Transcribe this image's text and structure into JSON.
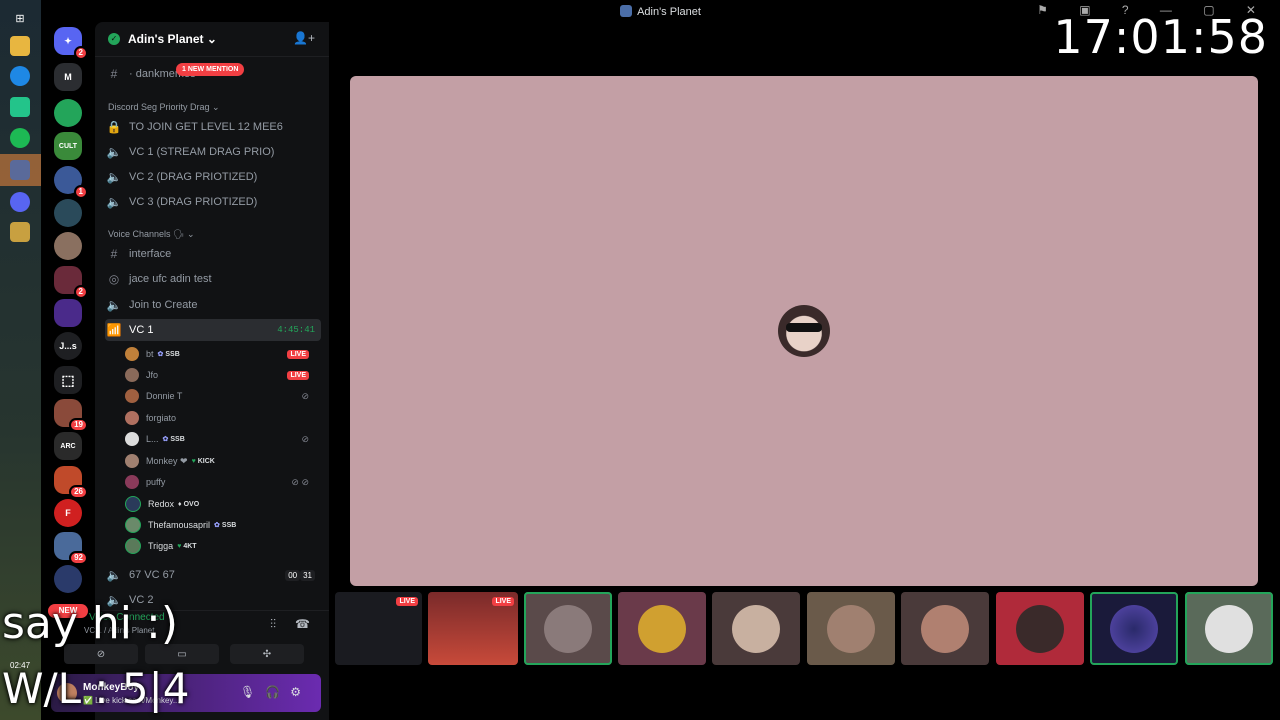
{
  "window": {
    "title": "Adin's Planet",
    "controls": "⚑ ▣ ? — ▢ ✕"
  },
  "clock": "17:01:58",
  "guilds": [
    {
      "name": "discord-home",
      "label": "",
      "color": "#5865f2",
      "badge": "2"
    },
    {
      "name": "mystic-madhouse",
      "label": "M",
      "color": "#2b2d31",
      "badge": ""
    },
    {
      "name": "green-hex",
      "label": "",
      "color": "#23a55a",
      "badge": ""
    },
    {
      "name": "battle-cult",
      "label": "CULT",
      "color": "#3a8a3a",
      "badge": ""
    },
    {
      "name": "server-5",
      "label": "",
      "color": "#3b5998",
      "badge": "1"
    },
    {
      "name": "server-6",
      "label": "",
      "color": "#2a4a5a",
      "badge": ""
    },
    {
      "name": "server-7",
      "label": "",
      "color": "#8a7060",
      "badge": ""
    },
    {
      "name": "server-8",
      "label": "",
      "color": "#6a2a3a",
      "badge": "2"
    },
    {
      "name": "server-9",
      "label": "",
      "color": "#4a2a8a",
      "badge": ""
    },
    {
      "name": "server-js",
      "label": "J...s",
      "color": "#1e1f22",
      "badge": ""
    },
    {
      "name": "server-11",
      "label": "",
      "color": "#1e1f22",
      "badge": ""
    },
    {
      "name": "server-12",
      "label": "",
      "color": "#8a4a3a",
      "badge": "19"
    },
    {
      "name": "arc-server",
      "label": "ARC",
      "color": "#2a2a2a",
      "badge": ""
    },
    {
      "name": "server-14",
      "label": "",
      "color": "#c04a2a",
      "badge": "26"
    },
    {
      "name": "server-15",
      "label": "F",
      "color": "#d02020",
      "badge": ""
    },
    {
      "name": "server-16",
      "label": "",
      "color": "#4a6a9a",
      "badge": "92"
    },
    {
      "name": "server-17",
      "label": "",
      "color": "#2a3a6a",
      "badge": ""
    }
  ],
  "new_label": "NEW",
  "server": {
    "name": "Adin's Planet ⌄"
  },
  "mention": "1 NEW MENTION",
  "channels": {
    "dankmemes": "· dankmemes",
    "cat1": "Discord Seg Priority Drag ⌄",
    "join": "TO JOIN GET LEVEL 12 MEE6",
    "vc1stream": "VC 1 (STREAM DRAG PRIO)",
    "vc2": "VC 2 (DRAG PRIOTIZED)",
    "vc3": "VC 3 (DRAG PRIOTIZED)",
    "cat2": "Voice Channels 🗣 ⌄",
    "interface": "interface",
    "jace": "jace ufc adin test",
    "create": "Join to Create",
    "vc1": "VC 1",
    "vc1_timer": "4:45:41",
    "vc67": "67 VC 67",
    "vc67_count_a": "00",
    "vc67_count_b": "31",
    "vc2b": "VC 2"
  },
  "voice_users": [
    {
      "name": "bt",
      "tag": "SSB",
      "live": "LIVE",
      "color": "#c0803a"
    },
    {
      "name": "Jfo",
      "tag": "",
      "live": "LIVE",
      "color": "#8a6a5a"
    },
    {
      "name": "Donnie T",
      "tag": "",
      "live": "",
      "color": "#a06040"
    },
    {
      "name": "forgiato",
      "tag": "",
      "live": "",
      "color": "#b07060"
    },
    {
      "name": "L...",
      "tag": "SSB",
      "live": "",
      "color": "#dcdcdc"
    },
    {
      "name": "Monkey ❤",
      "tag": "KICK",
      "live": "",
      "color": "#a08070"
    },
    {
      "name": "puffy",
      "tag": "",
      "live": "",
      "color": "#8a3a5a"
    },
    {
      "name": "Redox",
      "tag": "OVO",
      "live": "",
      "color": "#2a3a5a"
    },
    {
      "name": "Thefamousapril",
      "tag": "SSB",
      "live": "",
      "color": "#6a8a6a"
    },
    {
      "name": "Trigga",
      "tag": "4KT",
      "live": "",
      "color": "#5a7a5a"
    }
  ],
  "voice_panel": {
    "status": "Voice Connected",
    "sub": "VC 1 / Adin's Planet"
  },
  "user_panel": {
    "name": "MonkeyBoy",
    "status": "✅ Live kick.com/Monkey..."
  },
  "overlay": {
    "line1": "say hi :)",
    "line2": "W/L : 5|4"
  },
  "mini_time": "02:47",
  "thumb_live": "LIVE"
}
